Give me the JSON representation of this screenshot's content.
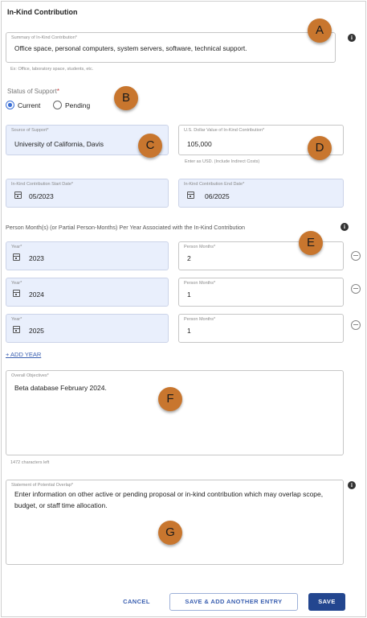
{
  "title": "In-Kind Contribution",
  "summary": {
    "label": "Summary of In-Kind Contribution",
    "value": "Office space, personal computers, system servers, software, technical support.",
    "hint": "Ex: Office, laboratory space, students, etc."
  },
  "status": {
    "label": "Status of Support",
    "options": [
      "Current",
      "Pending"
    ],
    "selected": "Current"
  },
  "source": {
    "label": "Source of Support",
    "value": "University of California, Davis"
  },
  "dollar": {
    "label": "U.S. Dollar Value of In-Kind Contribution",
    "value": "105,000",
    "hint": "Enter as USD. (Include Indirect Costs)"
  },
  "start_date": {
    "label": "In-Kind Contribution Start Date",
    "value": "05/2023"
  },
  "end_date": {
    "label": "In-Kind Contribution End Date",
    "value": "06/2025"
  },
  "person_months_heading": "Person Month(s) (or Partial Person-Months) Per Year Associated with the In-Kind Contribution",
  "year_rows": [
    {
      "year_label": "Year",
      "year": "2023",
      "months_label": "Person Months",
      "months": "2"
    },
    {
      "year_label": "Year",
      "year": "2024",
      "months_label": "Person Months",
      "months": "1"
    },
    {
      "year_label": "Year",
      "year": "2025",
      "months_label": "Person Months",
      "months": "1"
    }
  ],
  "add_year": "+ ADD YEAR",
  "objectives": {
    "label": "Overall Objectives",
    "value": "Beta database February 2024.",
    "hint": "1472 characters left"
  },
  "overlap": {
    "label": "Statement of Potential Overlap",
    "value": "Enter information on other active or pending proposal or in-kind contribution which may overlap scope, budget, or staff time allocation."
  },
  "buttons": {
    "cancel": "CANCEL",
    "save_add": "SAVE & ADD ANOTHER ENTRY",
    "save": "SAVE"
  },
  "markers": [
    "A",
    "B",
    "C",
    "D",
    "E",
    "F",
    "G"
  ],
  "required_mark": "*",
  "info_glyph": "i",
  "colors": {
    "marker": "#c8762e",
    "primary": "#23468f",
    "accent": "#3b6fd6",
    "filled": "#e9effc"
  }
}
